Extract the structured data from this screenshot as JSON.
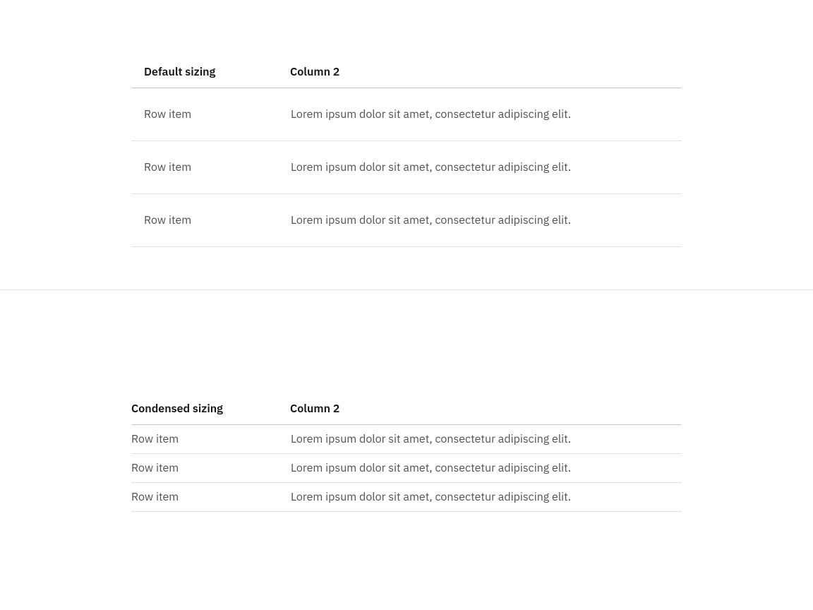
{
  "tables": {
    "default": {
      "headers": [
        "Default sizing",
        "Column 2"
      ],
      "rows": [
        [
          "Row item",
          "Lorem ipsum dolor sit amet, consectetur adipiscing elit."
        ],
        [
          "Row item",
          "Lorem ipsum dolor sit amet, consectetur adipiscing elit."
        ],
        [
          "Row item",
          "Lorem ipsum dolor sit amet, consectetur adipiscing elit."
        ]
      ]
    },
    "condensed": {
      "headers": [
        "Condensed sizing",
        "Column 2"
      ],
      "rows": [
        [
          "Row item",
          "Lorem ipsum dolor sit amet, consectetur adipiscing elit."
        ],
        [
          "Row item",
          "Lorem ipsum dolor sit amet, consectetur adipiscing elit."
        ],
        [
          "Row item",
          "Lorem ipsum dolor sit amet, consectetur adipiscing elit."
        ]
      ]
    }
  }
}
